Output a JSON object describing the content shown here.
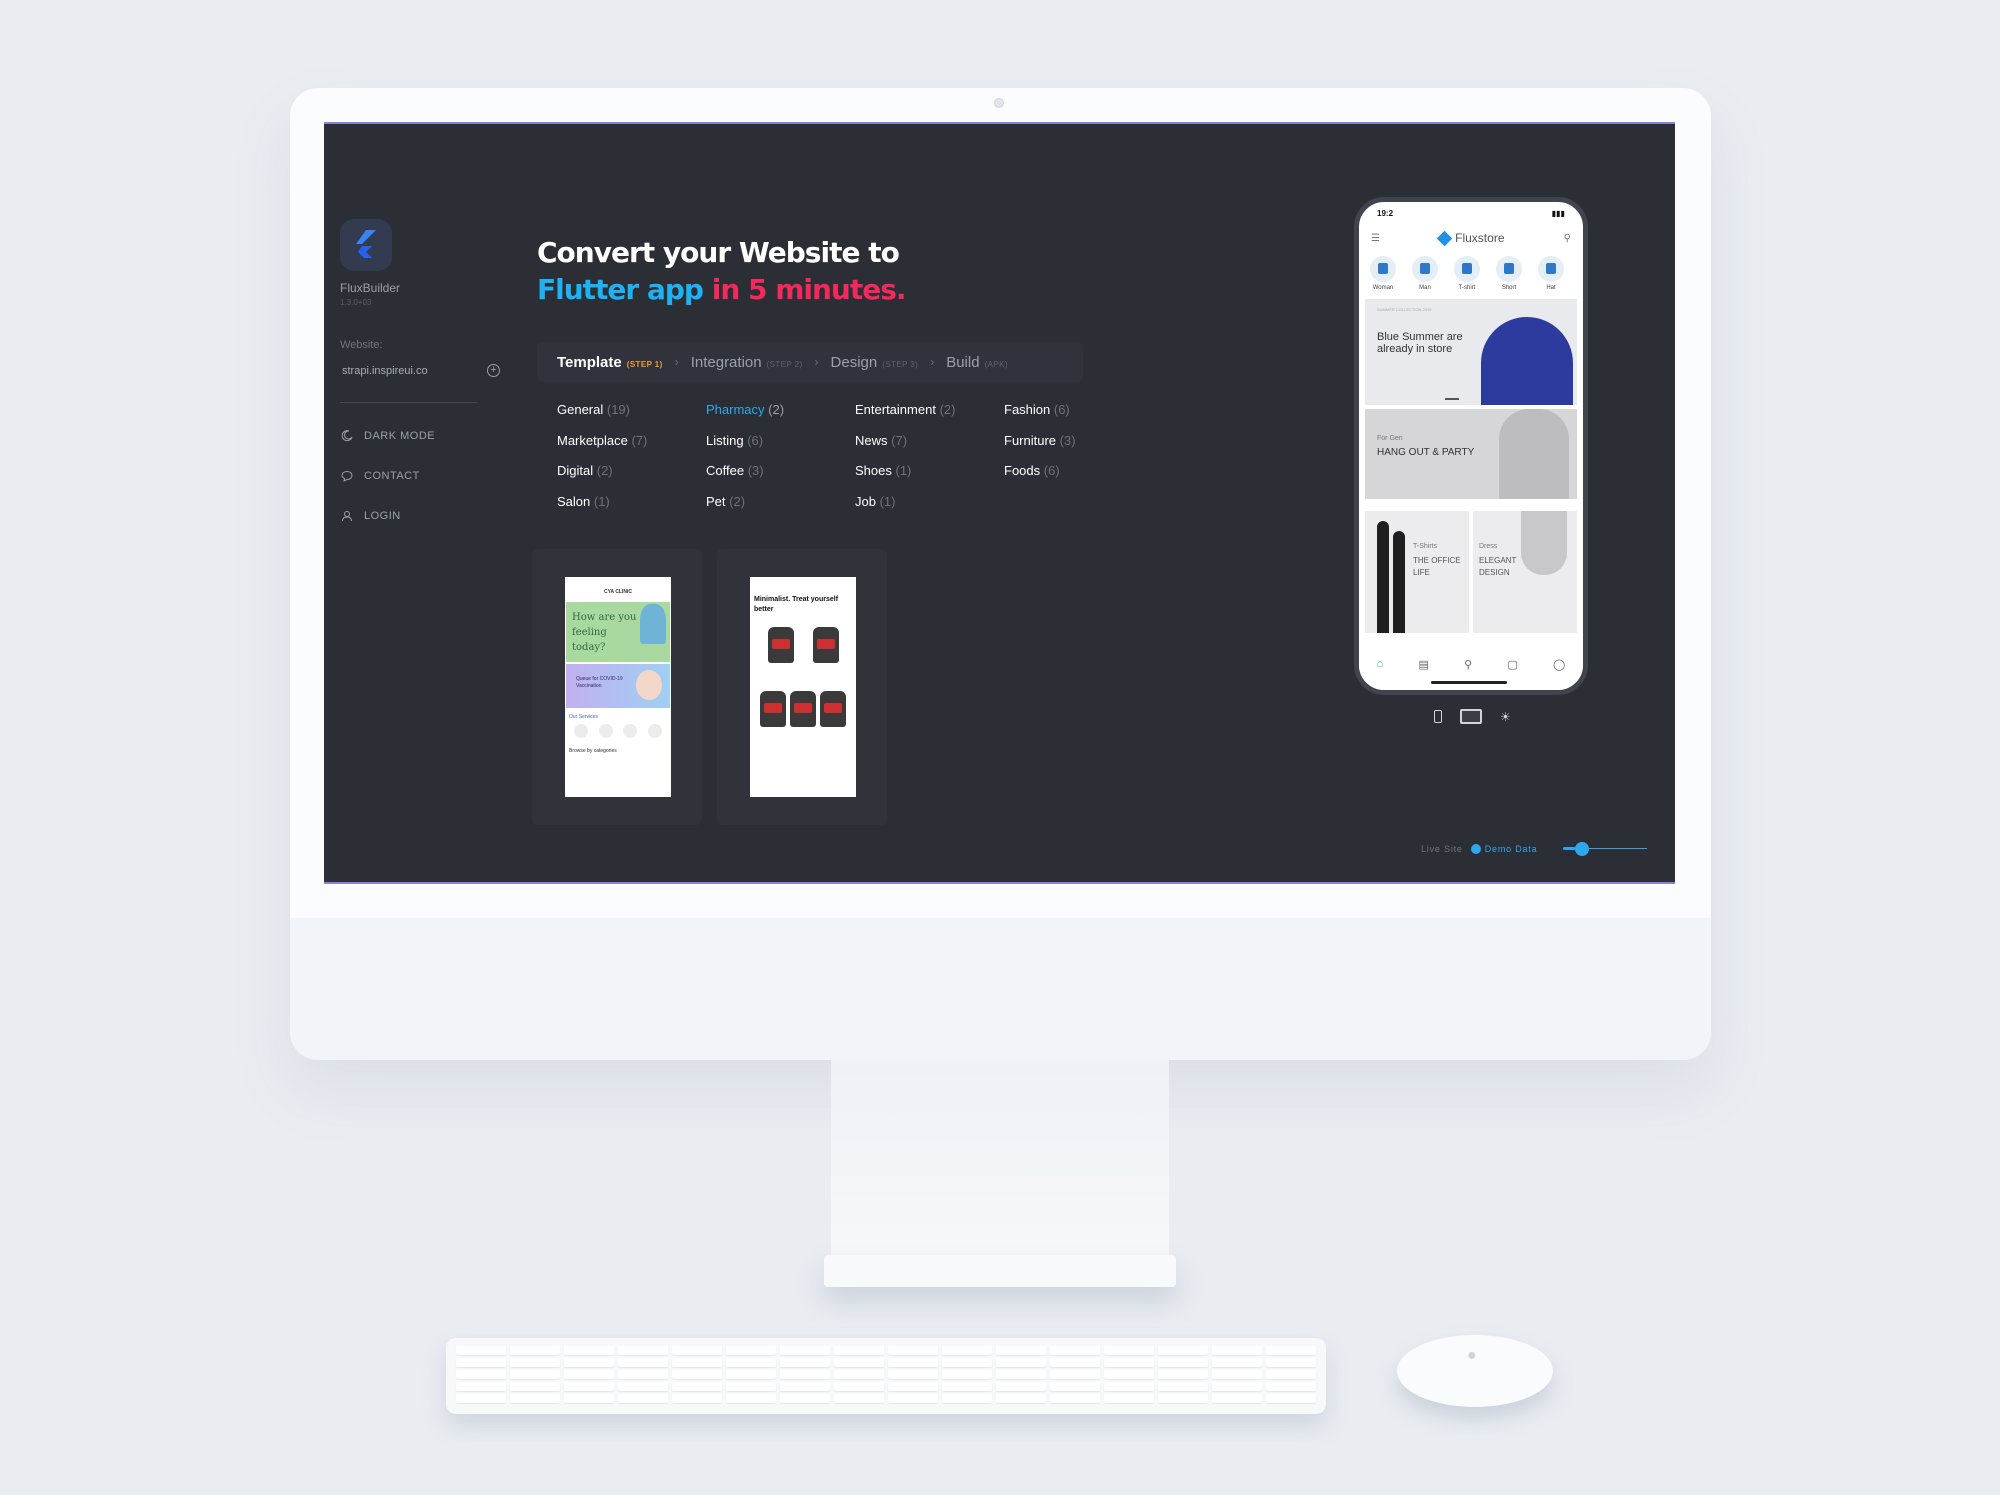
{
  "sidebar": {
    "app_name": "FluxBuilder",
    "version": "1.3.0+03",
    "website_label": "Website:",
    "website_value": "strapi.inspireui.co",
    "nav": [
      {
        "label": "DARK MODE",
        "icon": "moon-icon"
      },
      {
        "label": "CONTACT",
        "icon": "chat-bubble-icon"
      },
      {
        "label": "LOGIN",
        "icon": "user-icon"
      }
    ]
  },
  "headline": {
    "line1": "Convert your Website to",
    "line2_blue": "Flutter app",
    "line2_red": " in 5 minutes."
  },
  "steps": [
    {
      "label": "Template",
      "badge": "(STEP 1)",
      "active": true
    },
    {
      "label": "Integration",
      "badge": "(STEP 2)"
    },
    {
      "label": "Design",
      "badge": "(STEP 3)"
    },
    {
      "label": "Build",
      "badge": "(APK)"
    }
  ],
  "categories": [
    {
      "name": "General",
      "count": "(19)"
    },
    {
      "name": "Pharmacy",
      "count": "(2)",
      "active": true
    },
    {
      "name": "Entertainment",
      "count": "(2)"
    },
    {
      "name": "Fashion",
      "count": "(6)"
    },
    {
      "name": "Marketplace",
      "count": "(7)"
    },
    {
      "name": "Listing",
      "count": "(6)"
    },
    {
      "name": "News",
      "count": "(7)"
    },
    {
      "name": "Furniture",
      "count": "(3)"
    },
    {
      "name": "Digital",
      "count": "(2)"
    },
    {
      "name": "Coffee",
      "count": "(3)"
    },
    {
      "name": "Shoes",
      "count": "(1)"
    },
    {
      "name": "Foods",
      "count": "(6)"
    },
    {
      "name": "Salon",
      "count": "(1)"
    },
    {
      "name": "Pet",
      "count": "(2)"
    },
    {
      "name": "Job",
      "count": "(1)"
    }
  ],
  "templates": {
    "clinic": {
      "title": "CYA CLINIC",
      "hero": "How are you feeling today?",
      "banner": "Queue for COVID-19 Vaccination",
      "services": "Our Services",
      "browse": "Browse by categories"
    },
    "supplement": {
      "heading": "Minimalist. Treat yourself better"
    }
  },
  "phone": {
    "time": "19:2",
    "brand": "Fluxstore",
    "categories": [
      "Woman",
      "Man",
      "T-shirt",
      "Short",
      "Hat"
    ],
    "banner1_tag": "SUMMER COLLECTION 2019",
    "banner1_text": "Blue Summer are already in store",
    "banner2_tag": "For Gen",
    "banner2_text": "HANG OUT & PARTY",
    "tile1_tag": "T-Shirts",
    "tile1_text": "THE OFFICE LIFE",
    "tile2_tag": "Dress",
    "tile2_text": "ELEGANT DESIGN"
  },
  "footer": {
    "live_site": "Live Site",
    "demo_data": "Demo Data",
    "slider_value": 0.22
  },
  "colors": {
    "accent_blue": "#1eb2f3",
    "accent_red": "#f2295a",
    "step_badge": "#f29b33",
    "screen_bg": "#2b2e35"
  }
}
